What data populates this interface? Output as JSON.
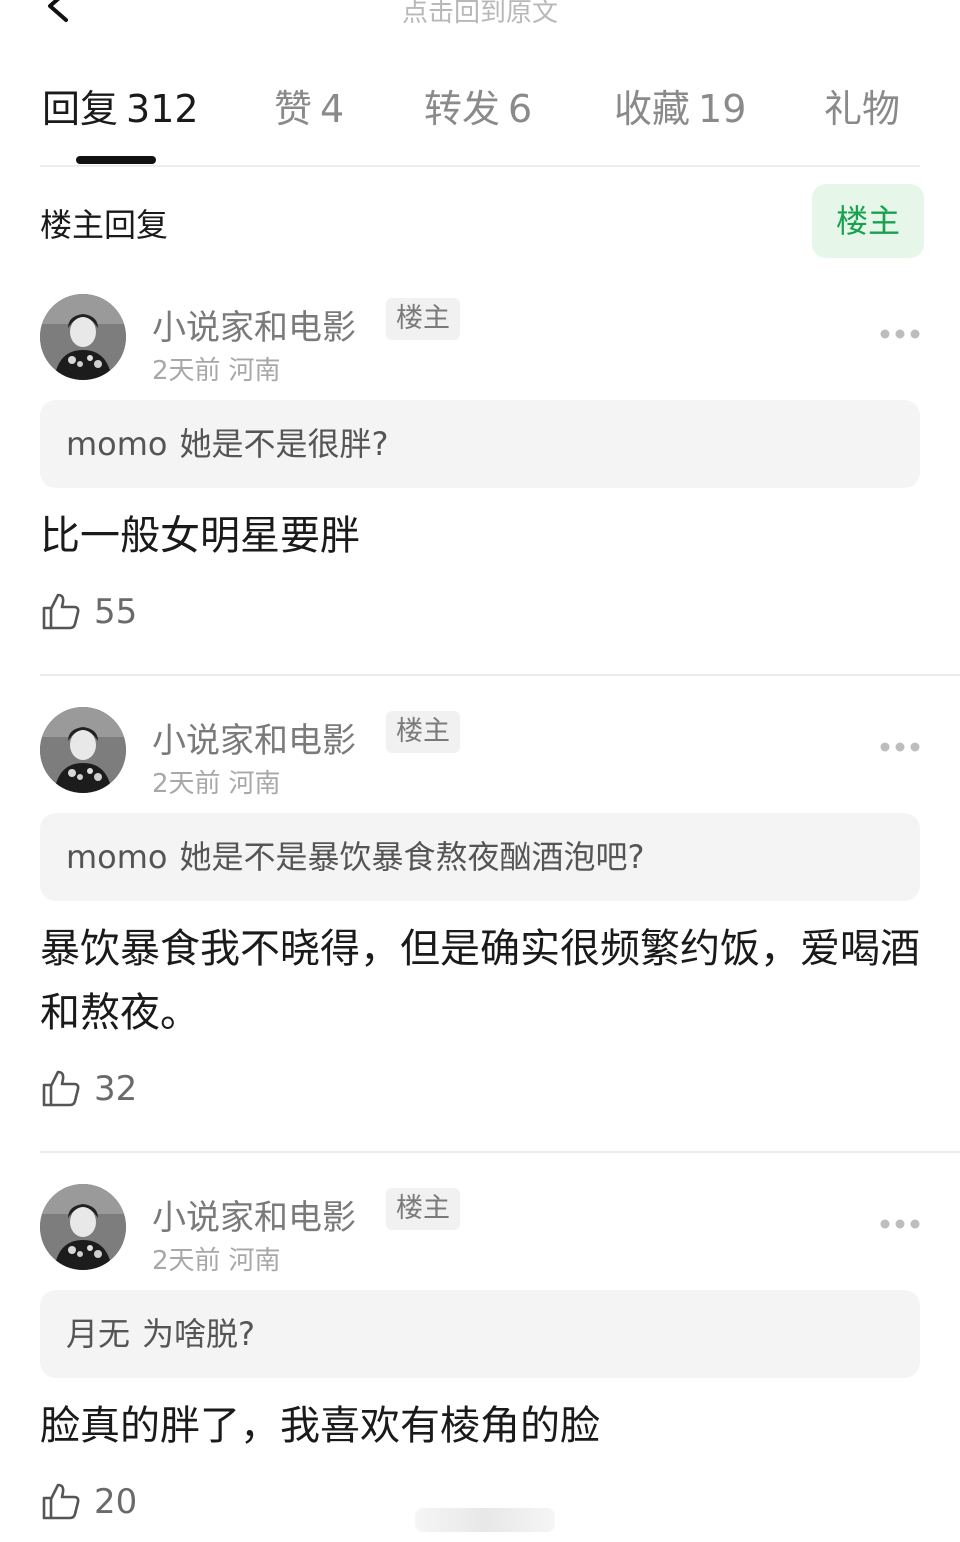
{
  "top_bar": {
    "back_to_original": "点击回到原文"
  },
  "tabs": [
    {
      "label": "回复",
      "count": "312",
      "active": true
    },
    {
      "label": "赞",
      "count": "4"
    },
    {
      "label": "转发",
      "count": "6"
    },
    {
      "label": "收藏",
      "count": "19"
    },
    {
      "label": "礼物",
      "count": ""
    }
  ],
  "filter": {
    "label": "楼主回复",
    "chip": "楼主"
  },
  "comments": [
    {
      "username": "小说家和电影",
      "badge": "楼主",
      "time": "2天前",
      "location": "河南",
      "quote_user": "momo",
      "quote_text": "她是不是很胖?",
      "text": "比一般女明星要胖",
      "likes": "55"
    },
    {
      "username": "小说家和电影",
      "badge": "楼主",
      "time": "2天前",
      "location": "河南",
      "quote_user": "momo",
      "quote_text": "她是不是暴饮暴食熬夜酗酒泡吧?",
      "text": "暴饮暴食我不晓得，但是确实很频繁约饭，爱喝酒和熬夜。",
      "likes": "32"
    },
    {
      "username": "小说家和电影",
      "badge": "楼主",
      "time": "2天前",
      "location": "河南",
      "quote_user": "月无",
      "quote_text": "为啥脱?",
      "text": "脸真的胖了，我喜欢有棱角的脸",
      "likes": "20"
    }
  ],
  "colors": {
    "accent_green": "#1aa14f",
    "chip_bg": "#e6f7ea",
    "text_primary": "#1a1a1a",
    "text_secondary": "#7a7a7a"
  },
  "icons": [
    "back-arrow-icon",
    "more-dots-icon",
    "thumbs-up-icon"
  ]
}
